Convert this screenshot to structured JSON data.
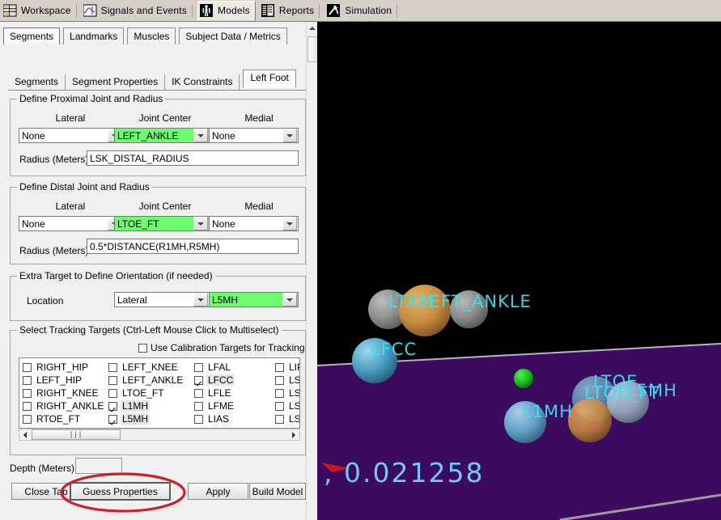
{
  "toolbar": {
    "items": [
      {
        "label": "Workspace",
        "icon": "workspace-grid-icon",
        "active": false
      },
      {
        "label": "Signals and Events",
        "icon": "signal-wave-icon",
        "active": false
      },
      {
        "label": "Models",
        "icon": "model-body-icon",
        "active": true
      },
      {
        "label": "Reports",
        "icon": "report-list-icon",
        "active": false
      },
      {
        "label": "Simulation",
        "icon": "simulation-runner-icon",
        "active": false
      }
    ]
  },
  "primary_tabs": [
    {
      "label": "Segments",
      "selected": true
    },
    {
      "label": "Landmarks",
      "selected": false
    },
    {
      "label": "Muscles",
      "selected": false
    },
    {
      "label": "Subject Data / Metrics",
      "selected": false
    }
  ],
  "secondary_tabs": [
    {
      "label": "Segments",
      "selected": false
    },
    {
      "label": "Segment Properties",
      "selected": false
    },
    {
      "label": "IK Constraints",
      "selected": false
    },
    {
      "label": "Left Foot",
      "selected": true
    }
  ],
  "proximal": {
    "title": "Define Proximal Joint and Radius",
    "col_lateral": "Lateral",
    "col_joint_center": "Joint Center",
    "col_medial": "Medial",
    "lateral_value": "None",
    "joint_center_value": "LEFT_ANKLE",
    "medial_value": "None",
    "radius_label": "Radius (Meters)",
    "radius_value": "LSK_DISTAL_RADIUS"
  },
  "distal": {
    "title": "Define Distal Joint and Radius",
    "col_lateral": "Lateral",
    "col_joint_center": "Joint Center",
    "col_medial": "Medial",
    "lateral_value": "None",
    "joint_center_value": "LTOE_FT",
    "medial_value": "None",
    "radius_label": "Radius (Meters)",
    "radius_value": "0.5*DISTANCE(R1MH,R5MH)"
  },
  "extra_target": {
    "title": "Extra Target to Define Orientation (if needed)",
    "location_label": "Location",
    "location_value": "Lateral",
    "target_value": "L5MH"
  },
  "tracking": {
    "title": "Select Tracking Targets (Ctrl-Left Mouse Click to Multiselect)",
    "use_calibration_label": "Use Calibration Targets for Tracking",
    "use_calibration_checked": false,
    "columns": [
      [
        {
          "label": "RIGHT_HIP",
          "checked": false
        },
        {
          "label": "LEFT_HIP",
          "checked": false
        },
        {
          "label": "RIGHT_KNEE",
          "checked": false
        },
        {
          "label": "RIGHT_ANKLE",
          "checked": false
        },
        {
          "label": "RTOE_FT",
          "checked": false
        }
      ],
      [
        {
          "label": "LEFT_KNEE",
          "checked": false
        },
        {
          "label": "LEFT_ANKLE",
          "checked": false
        },
        {
          "label": "LTOE_FT",
          "checked": false
        },
        {
          "label": "L1MH",
          "checked": true
        },
        {
          "label": "L5MH",
          "checked": true
        }
      ],
      [
        {
          "label": "LFAL",
          "checked": false
        },
        {
          "label": "LFCC",
          "checked": true
        },
        {
          "label": "LFLE",
          "checked": false
        },
        {
          "label": "LFME",
          "checked": false
        },
        {
          "label": "LIAS",
          "checked": false
        }
      ],
      [
        {
          "label": "LIPS",
          "checked": false
        },
        {
          "label": "LSHK",
          "checked": false
        },
        {
          "label": "LSHK",
          "checked": false
        },
        {
          "label": "LSHK",
          "checked": false
        },
        {
          "label": "LSHK",
          "checked": false
        }
      ]
    ],
    "hscroll_thumb_glyph": "∣∣∣"
  },
  "depth": {
    "label": "Depth (Meters):",
    "value": ""
  },
  "buttons": {
    "close_tab": "Close Tab",
    "guess_properties": "Guess Properties",
    "apply": "Apply",
    "build_model": "Build Model"
  },
  "annotation": {
    "shape": "red-ellipse-highlight",
    "color": "#cc1f28",
    "targets": "guess-properties-button"
  },
  "viewport": {
    "background_color": "#000000",
    "ground_color": "#3c0a5e",
    "label_color": "#3ae0ee",
    "readout": ", 0.021258",
    "markers": [
      {
        "name": "LTAM",
        "label": "LTAM",
        "color": "#8e8e8e"
      },
      {
        "name": "LEFT_ANKLE",
        "label": "LEFT_ANKLE",
        "color": "#cf9245"
      },
      {
        "name": "unlabeled-gray",
        "label": "",
        "color": "#8a8a8a"
      },
      {
        "name": "LFCC",
        "label": "LFCC",
        "color": "#3f9fc4"
      },
      {
        "name": "green-node",
        "label": "",
        "color": "#18b818"
      },
      {
        "name": "LTOE",
        "label": "LTOE",
        "color": "#5e99bb"
      },
      {
        "name": "L5MH",
        "label": "L5MH",
        "color": "#9fb8c5"
      },
      {
        "name": "LTOE_FT",
        "label": "LTOE_FT",
        "color": "#c98a4a"
      },
      {
        "name": "L1MH",
        "label": "L1MH",
        "color": "#5f9ec6"
      }
    ]
  }
}
